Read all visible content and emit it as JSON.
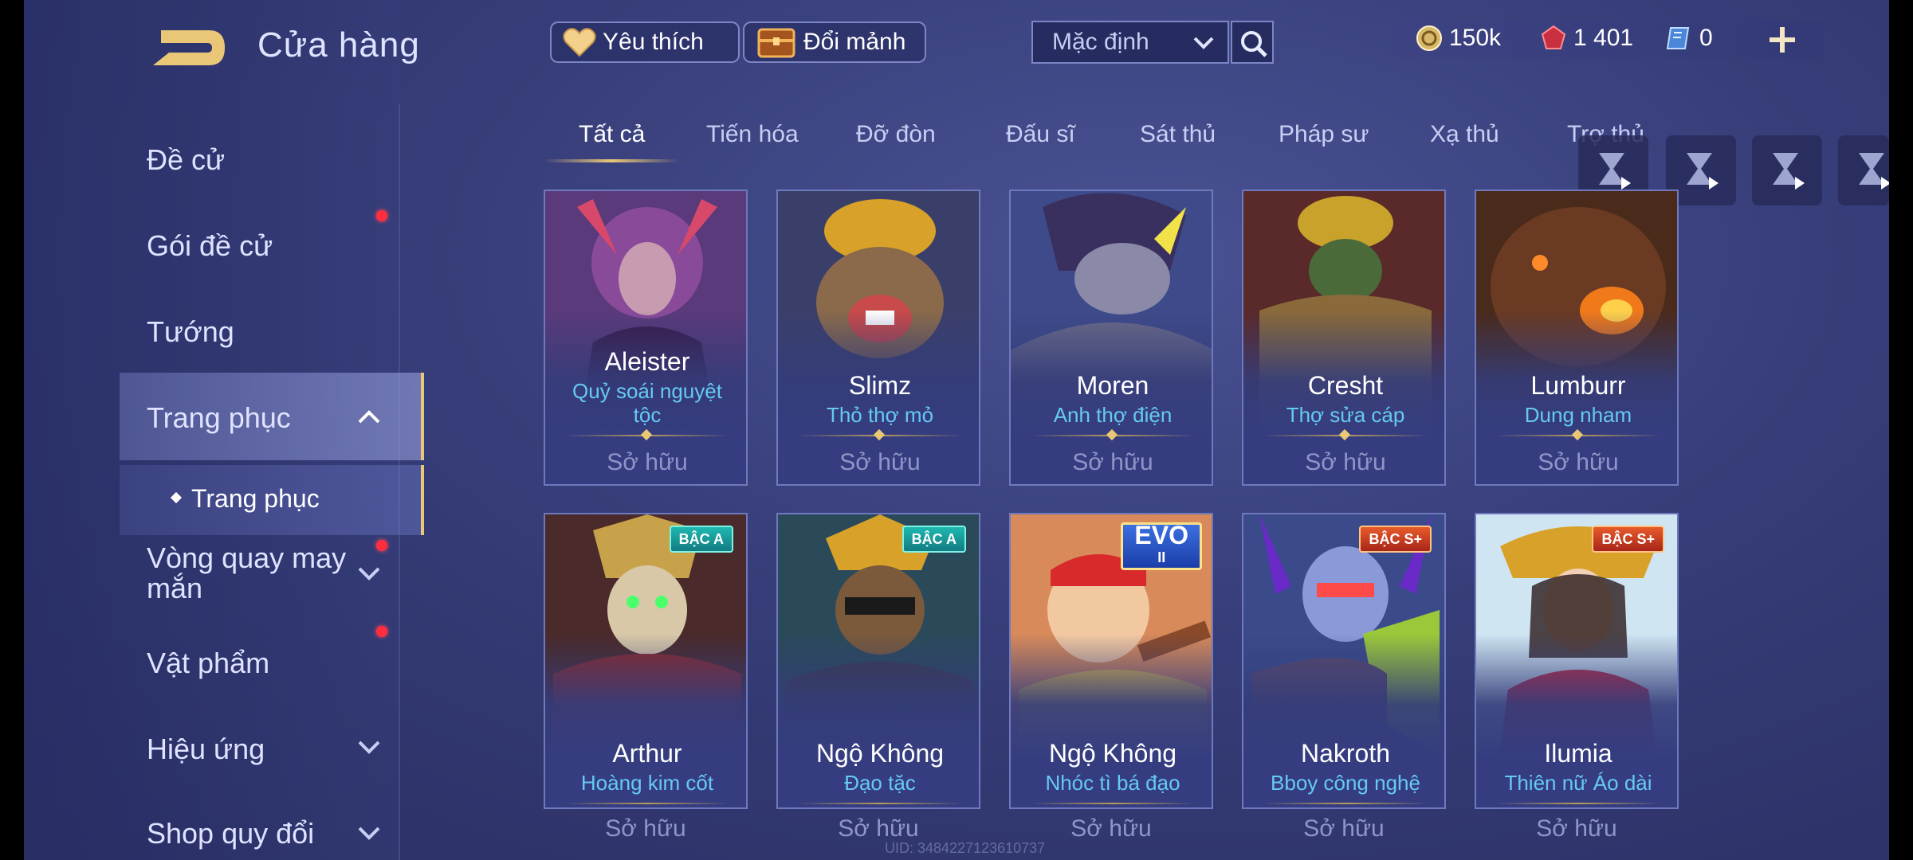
{
  "header": {
    "title": "Cửa hàng",
    "favorites_label": "Yêu thích",
    "shard_exchange_label": "Đổi mảnh",
    "sort_selected": "Mặc định"
  },
  "currencies": {
    "gold": "150k",
    "ruby": "1 401",
    "ticket": "0"
  },
  "sidebar": {
    "items": [
      {
        "label": "Đề cử"
      },
      {
        "label": "Gói đề cử"
      },
      {
        "label": "Tướng"
      },
      {
        "label": "Trang phục"
      },
      {
        "label": "Trang phục"
      },
      {
        "label": "Vòng quay may mắn"
      },
      {
        "label": "Vật phẩm"
      },
      {
        "label": "Hiệu ứng"
      },
      {
        "label": "Shop quy đổi"
      }
    ]
  },
  "tabs": [
    "Tất cả",
    "Tiến hóa",
    "Đỡ đòn",
    "Đấu sĩ",
    "Sát thủ",
    "Pháp sư",
    "Xạ thủ",
    "Trợ thủ"
  ],
  "cards": [
    {
      "name": "Aleister",
      "skin": "Quỷ soái nguyệt tộc",
      "status": "Sở hữu",
      "badge": ""
    },
    {
      "name": "Slimz",
      "skin": "Thỏ thợ mỏ",
      "status": "Sở hữu",
      "badge": ""
    },
    {
      "name": "Moren",
      "skin": "Anh thợ điện",
      "status": "Sở hữu",
      "badge": ""
    },
    {
      "name": "Cresht",
      "skin": "Thợ sửa cáp",
      "status": "Sở hữu",
      "badge": ""
    },
    {
      "name": "Lumburr",
      "skin": "Dung nham",
      "status": "Sở hữu",
      "badge": ""
    },
    {
      "name": "Arthur",
      "skin": "Hoàng kim cốt",
      "status": "Sở hữu",
      "badge": "BẬC A"
    },
    {
      "name": "Ngộ Không",
      "skin": "Đạo tặc",
      "status": "Sở hữu",
      "badge": "BẬC A"
    },
    {
      "name": "Ngộ Không",
      "skin": "Nhóc tì bá đạo",
      "status": "Sở hữu",
      "badge": "EVO",
      "badge_sub": "II"
    },
    {
      "name": "Nakroth",
      "skin": "Bboy công nghệ",
      "status": "Sở hữu",
      "badge": "BẬC S+"
    },
    {
      "name": "Ilumia",
      "skin": "Thiên nữ Áo dài",
      "status": "Sở hữu",
      "badge": "BẬC S+"
    }
  ],
  "uid": "UID: 3484227123610737",
  "colors": {
    "accent_gold": "#e9c777",
    "skin_text": "#66c9f3",
    "notification": "#ff2d3e"
  }
}
